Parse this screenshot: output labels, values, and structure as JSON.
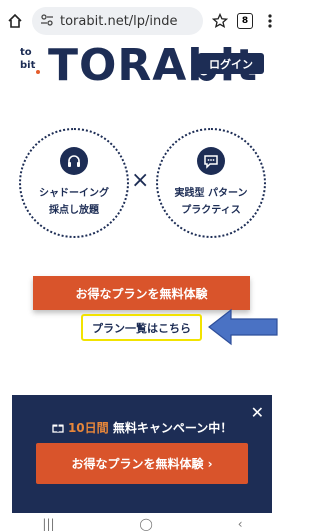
{
  "browser": {
    "url": "torabit.net/lp/inde",
    "tab_count": "8",
    "icons": [
      "home-icon",
      "site-settings-icon",
      "star-icon",
      "tabs-icon",
      "menu-icon"
    ]
  },
  "header": {
    "logo_mark_line1": "to",
    "logo_mark_line2": "bit",
    "logo_text": "TORAbit",
    "login_label": "ログイン"
  },
  "features": [
    {
      "icon": "headphones-icon",
      "line1": "シャドーイング",
      "line2": "採点し放題"
    },
    {
      "icon": "chat-icon",
      "line1": "実践型 パターン",
      "line2": "プラクティス"
    }
  ],
  "times_symbol": "×",
  "cta": {
    "main_label": "お得なプランを無料体験",
    "plan_link": "プラン一覧はこちら"
  },
  "banner": {
    "days": "10日間",
    "campaign": "無料キャンペーン中！",
    "cta_label": "お得なプランを無料体験 ›",
    "close": "✕"
  },
  "nav": {
    "recent": "|||",
    "home": "◯",
    "back": "‹"
  },
  "colors": {
    "navy": "#1d2d55",
    "orange": "#d9542b",
    "highlight": "#f2e300",
    "arrow": "#4a72c4"
  }
}
